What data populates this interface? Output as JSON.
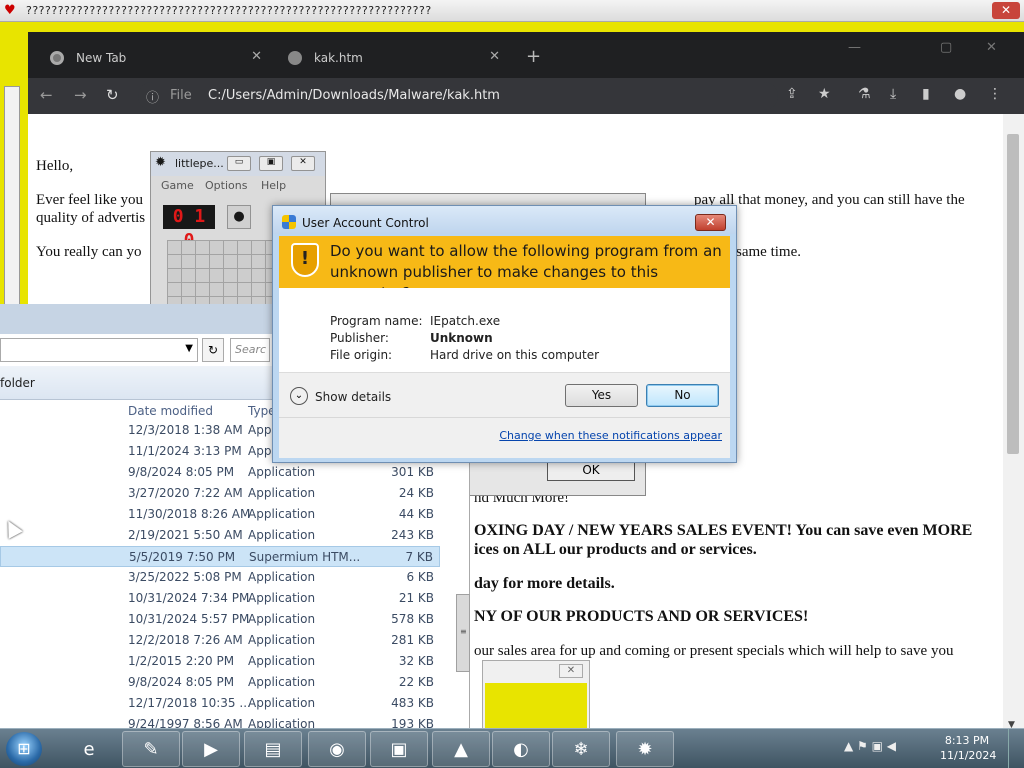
{
  "top_window": {
    "title": "????????????????????????????????????????????????????????????????",
    "close": "✕"
  },
  "browser": {
    "tabs": [
      {
        "label": "New Tab",
        "close": "✕"
      },
      {
        "label": "kak.htm",
        "close": "✕"
      }
    ],
    "new_tab": "+",
    "window_controls": {
      "min": "—",
      "max": "▢",
      "close": "✕"
    },
    "nav": {
      "back": "←",
      "forward": "→",
      "reload": "↻"
    },
    "address": {
      "info_icon": "ⓘ",
      "scheme_label": "File",
      "url": "C:/Users/Admin/Downloads/Malware/kak.htm"
    },
    "toolbar_icons": [
      "⇪",
      "★",
      "⚗",
      "⤓",
      "▮",
      "●",
      "⋮"
    ]
  },
  "page": {
    "hello": "Hello,",
    "line1a": "Ever feel like you",
    "line1b": "pay all that money, and you can still have the",
    "line2": "quality of advertis",
    "line3a": "You really can yo",
    "line3b": "same time.",
    "line4": "nd Much More!",
    "line5": "OXING DAY / NEW YEARS SALES EVENT! You can save even MORE",
    "line6": "ices on ALL our products and or services.",
    "line7": "day for more details.",
    "line8": "NY OF OUR PRODUCTS AND OR SERVICES!",
    "line9": "our sales area for up and coming or present specials which will help to save you"
  },
  "minesweeper": {
    "title": "littlepe...",
    "menus": [
      "Game",
      "Options",
      "Help"
    ],
    "counter": "0 1 0",
    "face": "●"
  },
  "ok_dialog": {
    "ok_label": "OK"
  },
  "explorer": {
    "refresh": "↻",
    "search_placeholder": "Searc",
    "toolbar_label": "folder",
    "columns": {
      "date": "Date modified",
      "type": "Type"
    },
    "rows": [
      {
        "date": "12/3/2018 1:38 AM",
        "type": "Appl",
        "size": ""
      },
      {
        "date": "11/1/2024 3:13 PM",
        "type": "Appl",
        "size": ""
      },
      {
        "date": "9/8/2024 8:05 PM",
        "type": "Application",
        "size": "301 KB"
      },
      {
        "date": "3/27/2020 7:22 AM",
        "type": "Application",
        "size": "24 KB"
      },
      {
        "date": "11/30/2018 8:26 AM",
        "type": "Application",
        "size": "44 KB"
      },
      {
        "date": "2/19/2021 5:50 AM",
        "type": "Application",
        "size": "243 KB"
      },
      {
        "date": "5/5/2019 7:50 PM",
        "type": "Supermium HTM...",
        "size": "7 KB"
      },
      {
        "date": "3/25/2022 5:08 PM",
        "type": "Application",
        "size": "6 KB"
      },
      {
        "date": "10/31/2024 7:34 PM",
        "type": "Application",
        "size": "21 KB"
      },
      {
        "date": "10/31/2024 5:57 PM",
        "type": "Application",
        "size": "578 KB"
      },
      {
        "date": "12/2/2018 7:26 AM",
        "type": "Application",
        "size": "281 KB"
      },
      {
        "date": "1/2/2015 2:20 PM",
        "type": "Application",
        "size": "32 KB"
      },
      {
        "date": "9/8/2024 8:05 PM",
        "type": "Application",
        "size": "22 KB"
      },
      {
        "date": "12/17/2018 10:35 ...",
        "type": "Application",
        "size": "483 KB"
      },
      {
        "date": "9/24/1997 8:56 AM",
        "type": "Application",
        "size": "193 KB"
      }
    ]
  },
  "uac": {
    "title": "User Account Control",
    "close": "✕",
    "question": "Do you want to allow the following program from an unknown publisher to make changes to this computer?",
    "fields": [
      {
        "label": "Program name:",
        "value": "IEpatch.exe"
      },
      {
        "label": "Publisher:",
        "value": "Unknown"
      },
      {
        "label": "File origin:",
        "value": "Hard drive on this computer"
      }
    ],
    "show_details": "Show details",
    "yes": "Yes",
    "no": "No",
    "link": "Change when these notifications appear"
  },
  "taskbar": {
    "start": "⊞",
    "items": [
      "e",
      "✎",
      "▶",
      "▤",
      "◉",
      "▣",
      "▲",
      "◐",
      "❄",
      "✹"
    ],
    "clock_time": "8:13 PM",
    "clock_date": "11/1/2024",
    "tray": "▲ ⚑ ▣ ◀"
  }
}
